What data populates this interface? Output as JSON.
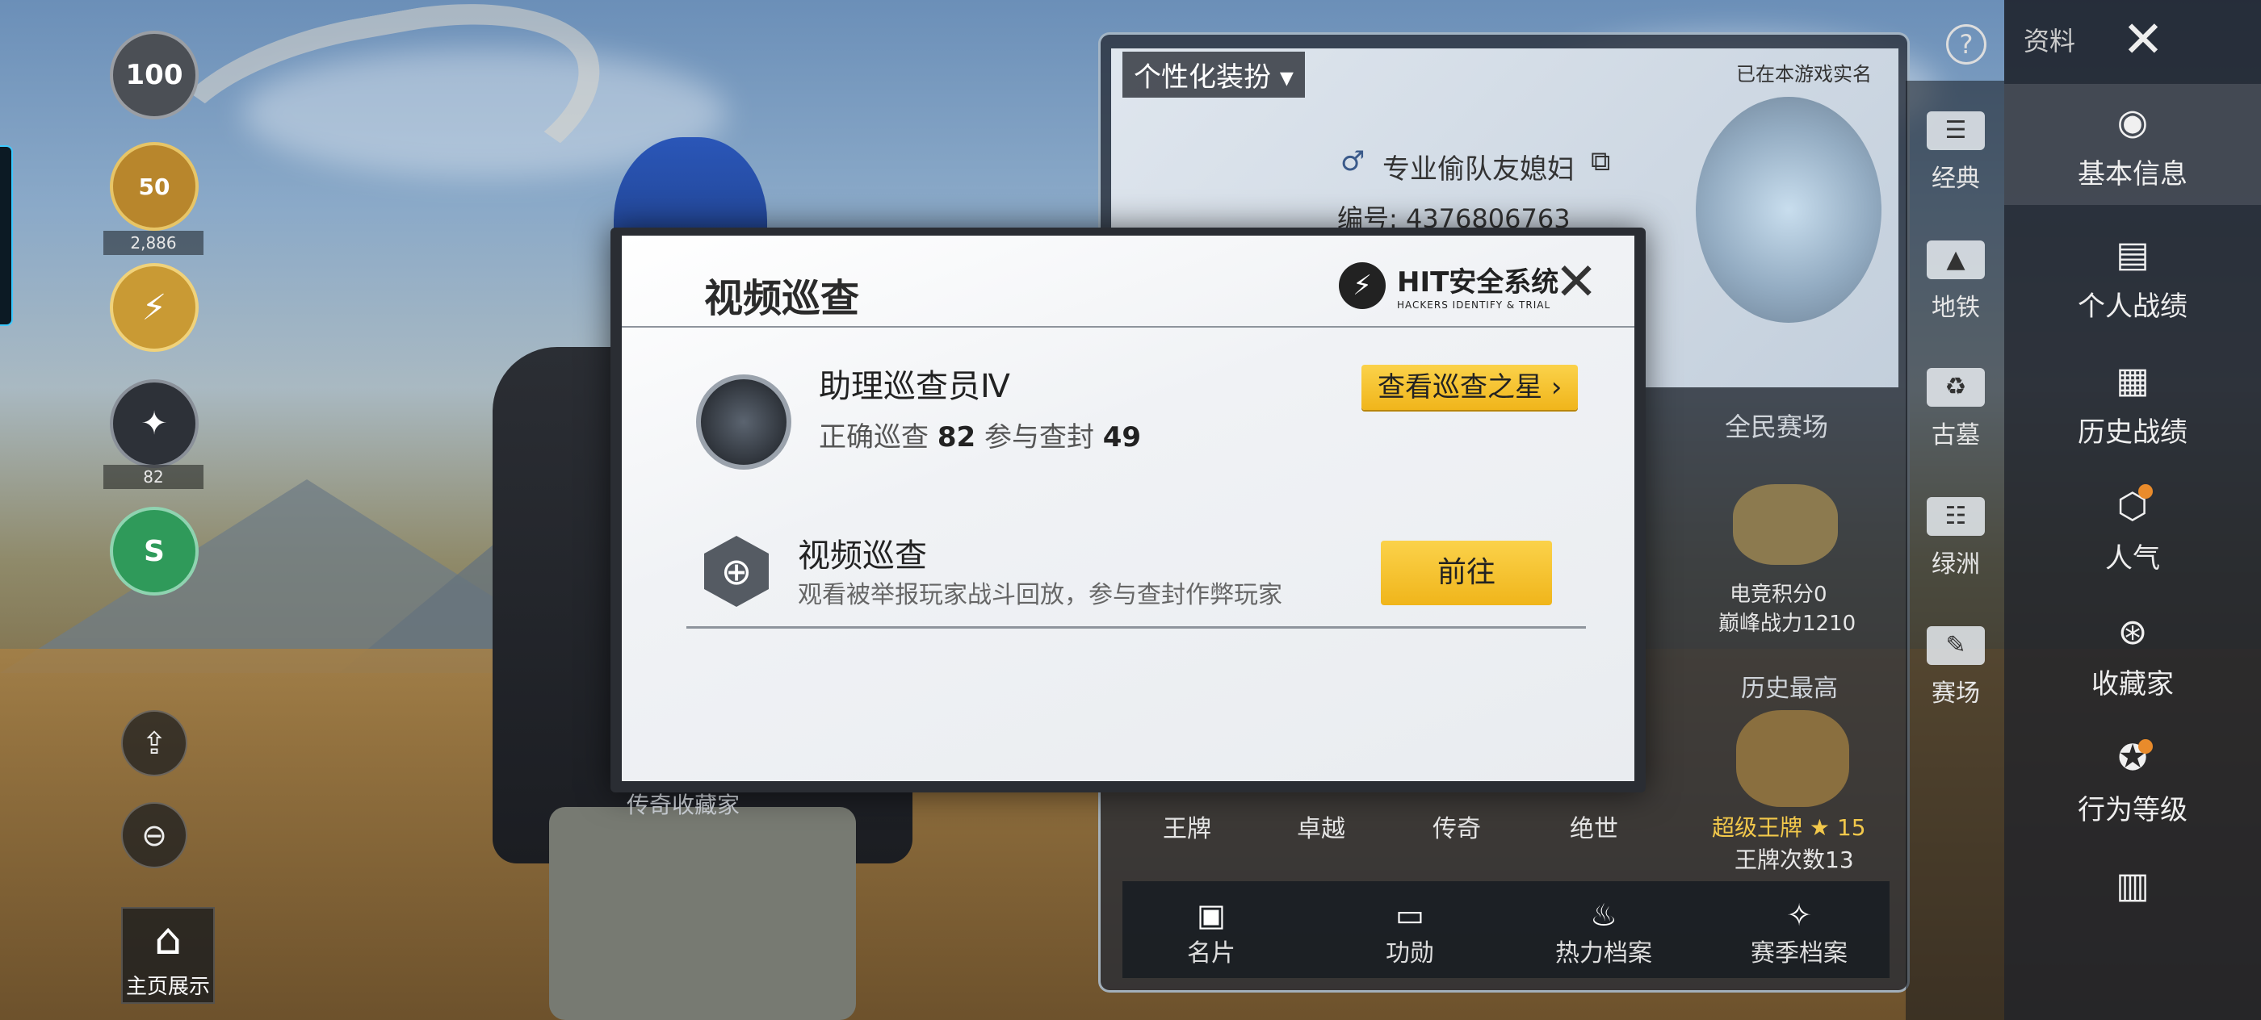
{
  "left": {
    "level_badge": "100",
    "tier_badge_num": "50",
    "tier_count": "2,886",
    "emblem_count": "82",
    "shield_letter": "S",
    "home_label": "主页展示"
  },
  "profile": {
    "outfit_label": "个性化装扮",
    "realname_label": "已在本游戏实名",
    "nickname": "专业偷队友媳妇",
    "id_label": "编号: 4376806763",
    "mode_title": "全民赛场",
    "score_text": "电竞积分0",
    "peak_power": "巅峰战力1210",
    "history_title": "历史最高",
    "super_ace": "超级王牌",
    "super_ace_level": "15",
    "ace_count": "王牌次数13",
    "tier_labels": [
      "王牌",
      "卓越",
      "传奇",
      "绝世"
    ],
    "title_plate": "传奇收藏家",
    "bottom_tabs": [
      "名片",
      "功勋",
      "热力档案",
      "赛季档案"
    ]
  },
  "top_right": {
    "help_icon": "?",
    "section_label": "资料",
    "close_icon": "✕"
  },
  "nav_maps": [
    {
      "label": "经典",
      "icon": "card-icon"
    },
    {
      "label": "地铁",
      "icon": "mountain-icon"
    },
    {
      "label": "古墓",
      "icon": "tomb-icon"
    },
    {
      "label": "绿洲",
      "icon": "oasis-icon"
    },
    {
      "label": "赛场",
      "icon": "arena-icon"
    }
  ],
  "nav_main": [
    {
      "label": "基本信息",
      "icon": "profile-icon",
      "active": true
    },
    {
      "label": "个人战绩",
      "icon": "stats-icon"
    },
    {
      "label": "历史战绩",
      "icon": "history-icon"
    },
    {
      "label": "人气",
      "icon": "popularity-icon"
    },
    {
      "label": "收藏家",
      "icon": "collector-icon"
    },
    {
      "label": "行为等级",
      "icon": "behavior-icon"
    }
  ],
  "modal": {
    "title": "视频巡查",
    "logo_main": "HIT安全系统",
    "logo_sub": "HACKERS IDENTIFY & TRIAL",
    "rank_title": "助理巡查员Ⅳ",
    "correct_label": "正确巡查",
    "correct_value": "82",
    "ban_label": "参与查封",
    "ban_value": "49",
    "star_button": "查看巡查之星 ›",
    "feature_title": "视频巡查",
    "feature_desc": "观看被举报玩家战斗回放，参与查封作弊玩家",
    "go_button": "前往"
  }
}
